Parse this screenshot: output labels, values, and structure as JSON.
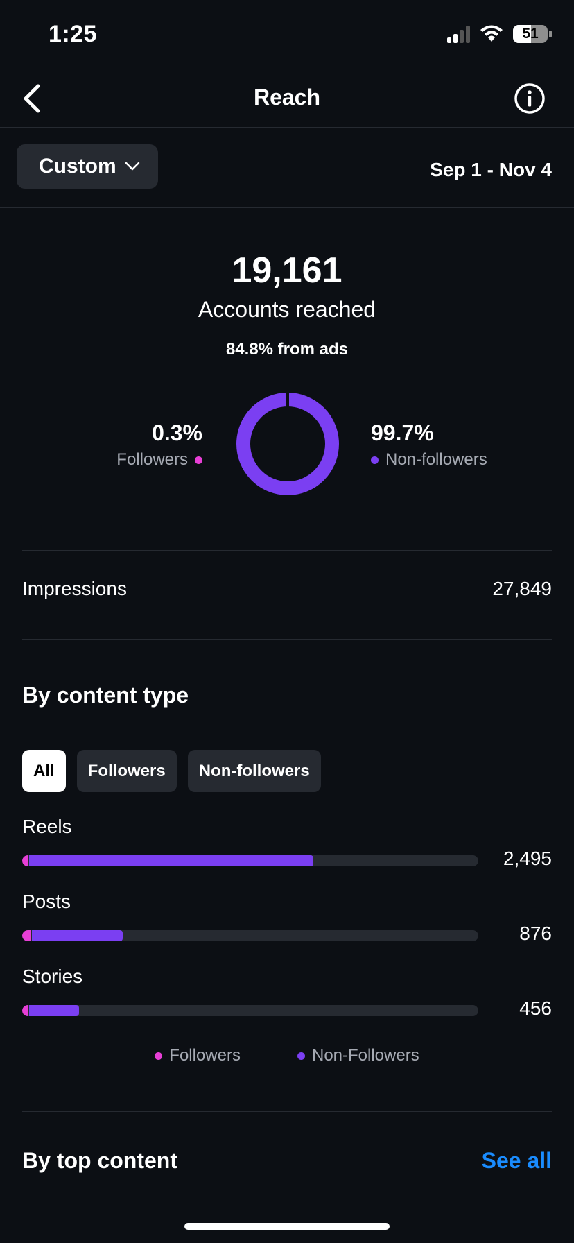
{
  "status_bar": {
    "time": "1:25",
    "battery_level": "51"
  },
  "header": {
    "title": "Reach"
  },
  "filter": {
    "range_label": "Custom",
    "date_range": "Sep 1 - Nov 4"
  },
  "summary": {
    "accounts_reached": "19,161",
    "accounts_label": "Accounts reached",
    "ads_note": "84.8% from ads",
    "followers_pct": "0.3%",
    "followers_label": "Followers",
    "non_followers_pct": "99.7%",
    "non_followers_label": "Non-followers",
    "followers_fraction": 0.003
  },
  "impressions": {
    "label": "Impressions",
    "value": "27,849"
  },
  "content_type": {
    "title": "By content type",
    "chips": [
      "All",
      "Followers",
      "Non-followers"
    ],
    "active_chip": "All",
    "rows": [
      {
        "label": "Reels",
        "value": "2,495",
        "followers_share": 0.012,
        "non_followers_share": 0.623
      },
      {
        "label": "Posts",
        "value": "876",
        "followers_share": 0.018,
        "non_followers_share": 0.2
      },
      {
        "label": "Stories",
        "value": "456",
        "followers_share": 0.012,
        "non_followers_share": 0.11
      }
    ],
    "legend": {
      "followers": "Followers",
      "non_followers": "Non-Followers"
    }
  },
  "top_content": {
    "title": "By top content",
    "see_all": "See all"
  },
  "colors": {
    "followers": "#e83fd6",
    "non_followers": "#7b3ff2",
    "link": "#1a8cff",
    "background": "#0c0f14"
  },
  "icons": {
    "back": "chevron-left-icon",
    "info": "info-icon",
    "dropdown": "chevron-down-icon"
  }
}
